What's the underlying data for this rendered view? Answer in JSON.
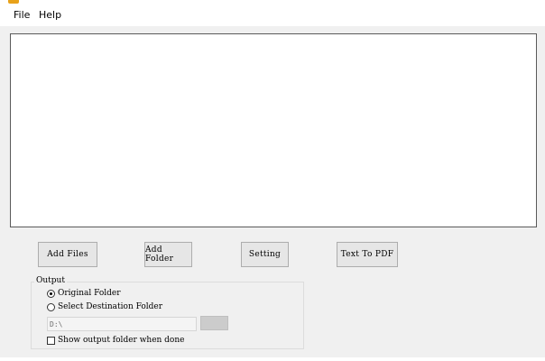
{
  "menubar": {
    "items": [
      {
        "label": "File"
      },
      {
        "label": "Help"
      }
    ]
  },
  "toolbar": {
    "add_files_label": "Add Files",
    "add_folder_label": "Add Folder",
    "setting_label": "Setting",
    "convert_label": "Text To PDF"
  },
  "output": {
    "group_label": "Output",
    "original_folder_label": "Original Folder",
    "original_folder_selected": true,
    "select_destination_label": "Select Destination Folder",
    "select_destination_selected": false,
    "path_value": "D:\\",
    "path_enabled": false,
    "show_folder_label": "Show output folder when done",
    "show_folder_checked": false
  },
  "colors": {
    "window_bg": "#f0f0f0",
    "list_bg": "#ffffff",
    "button_bg": "#e6e6e6",
    "button_border": "#adadad"
  }
}
